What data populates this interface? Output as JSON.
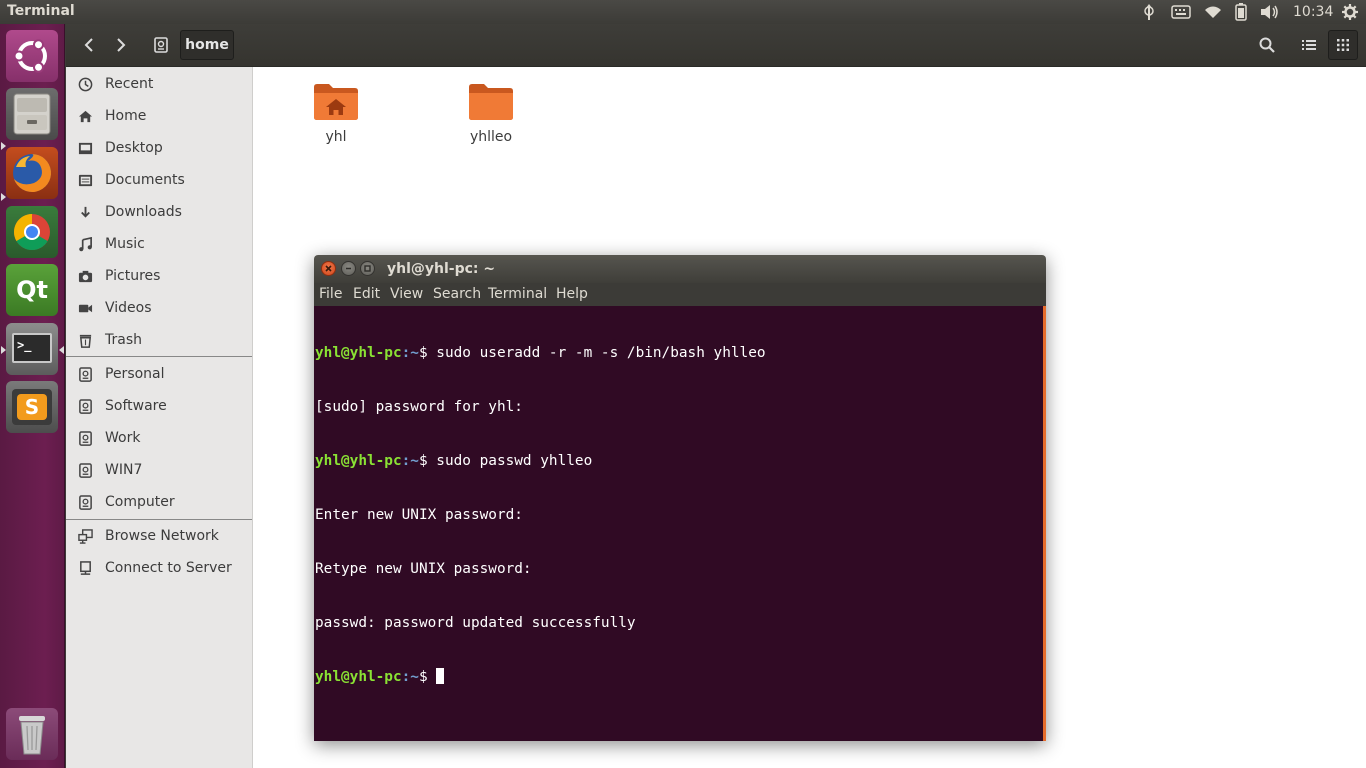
{
  "top_panel": {
    "app_title": "Terminal",
    "clock": "10:34",
    "indicators": [
      "input-method-icon",
      "keyboard-icon",
      "wifi-icon",
      "battery-icon",
      "volume-icon",
      "gear-icon"
    ]
  },
  "launcher": {
    "items": [
      {
        "name": "dash",
        "icon": "ubuntu-logo-icon"
      },
      {
        "name": "files",
        "icon": "file-cabinet-icon"
      },
      {
        "name": "firefox",
        "icon": "firefox-icon"
      },
      {
        "name": "chrome",
        "icon": "chrome-icon"
      },
      {
        "name": "qt-creator",
        "icon": "qt-icon"
      },
      {
        "name": "terminal",
        "icon": "terminal-icon"
      },
      {
        "name": "sublime-text",
        "icon": "sublime-icon"
      },
      {
        "name": "trash",
        "icon": "trash-icon"
      }
    ],
    "qt_label": "Qt",
    "sublime_label": "S",
    "terminal_label": ">_"
  },
  "nautilus": {
    "path_segment": "home",
    "sidebar": {
      "places": [
        {
          "label": "Recent",
          "icon": "clock-icon"
        },
        {
          "label": "Home",
          "icon": "home-icon"
        },
        {
          "label": "Desktop",
          "icon": "desktop-icon"
        },
        {
          "label": "Documents",
          "icon": "documents-icon"
        },
        {
          "label": "Downloads",
          "icon": "download-icon"
        },
        {
          "label": "Music",
          "icon": "music-icon"
        },
        {
          "label": "Pictures",
          "icon": "camera-icon"
        },
        {
          "label": "Videos",
          "icon": "video-icon"
        },
        {
          "label": "Trash",
          "icon": "trash-icon"
        }
      ],
      "devices": [
        {
          "label": "Personal",
          "icon": "drive-icon"
        },
        {
          "label": "Software",
          "icon": "drive-icon"
        },
        {
          "label": "Work",
          "icon": "drive-icon"
        },
        {
          "label": "WIN7",
          "icon": "drive-icon"
        },
        {
          "label": "Computer",
          "icon": "drive-icon"
        }
      ],
      "network": [
        {
          "label": "Browse Network",
          "icon": "network-icon"
        },
        {
          "label": "Connect to Server",
          "icon": "server-icon"
        }
      ]
    },
    "folders": [
      {
        "label": "yhl",
        "icon": "home-folder-icon"
      },
      {
        "label": "yhlleo",
        "icon": "folder-icon"
      }
    ]
  },
  "terminal": {
    "title": "yhl@yhl-pc: ~",
    "menu": [
      "File",
      "Edit",
      "View",
      "Search",
      "Terminal",
      "Help"
    ],
    "prompt_user": "yhl@yhl-pc",
    "prompt_path": ":~",
    "lines": [
      {
        "prompt": true,
        "text": "$ sudo useradd -r -m -s /bin/bash yhlleo"
      },
      {
        "prompt": false,
        "text": "[sudo] password for yhl:"
      },
      {
        "prompt": true,
        "text": "$ sudo passwd yhlleo"
      },
      {
        "prompt": false,
        "text": "Enter new UNIX password:"
      },
      {
        "prompt": false,
        "text": "Retype new UNIX password:"
      },
      {
        "prompt": false,
        "text": "passwd: password updated successfully"
      },
      {
        "prompt": true,
        "text": "$ "
      }
    ],
    "colors": {
      "background": "#300a24",
      "prompt_user": "#8ae234",
      "prompt_path": "#729fcf",
      "accent": "#e66c2c"
    }
  }
}
